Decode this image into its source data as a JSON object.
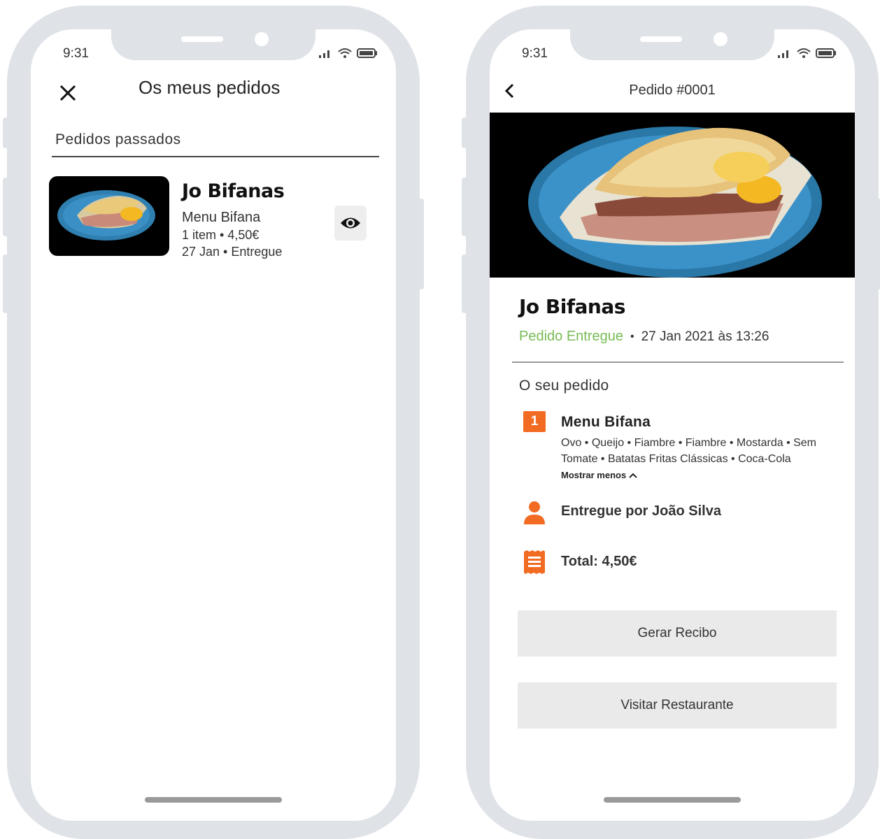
{
  "status_bar": {
    "time": "9:31"
  },
  "orders_screen": {
    "title": "Os meus pedidos",
    "section_label": "Pedidos passados",
    "orders": [
      {
        "restaurant": "Jo Bifanas",
        "menu": "Menu Bifana",
        "items_price": "1 item • 4,50€",
        "date_status": "27 Jan • Entregue"
      }
    ]
  },
  "detail_screen": {
    "title": "Pedido #0001",
    "restaurant": "Jo Bifanas",
    "status": "Pedido Entregue",
    "separator": "•",
    "datetime": "27 Jan 2021 às 13:26",
    "section_label": "O seu pedido",
    "item": {
      "quantity": "1",
      "name": "Menu Bifana",
      "options": "Ovo • Queijo • Fiambre • Fiambre • Mostarda • Sem Tomate • Batatas Fritas Clássicas • Coca-Cola",
      "toggle_label": "Mostrar menos"
    },
    "delivered_by": "Entregue por João Silva",
    "total": "Total: 4,50€",
    "buttons": {
      "receipt": "Gerar Recibo",
      "visit": "Visitar Restaurante"
    }
  },
  "colors": {
    "accent": "#f26b22",
    "status_green": "#77bb55",
    "phone_frame": "#dfe2e7",
    "button_bg": "#eaeaea"
  },
  "icons": [
    "close-icon",
    "eye-icon",
    "back-icon",
    "person-icon",
    "receipt-icon",
    "chevron-up-icon",
    "signal-icon",
    "wifi-icon",
    "battery-icon"
  ]
}
